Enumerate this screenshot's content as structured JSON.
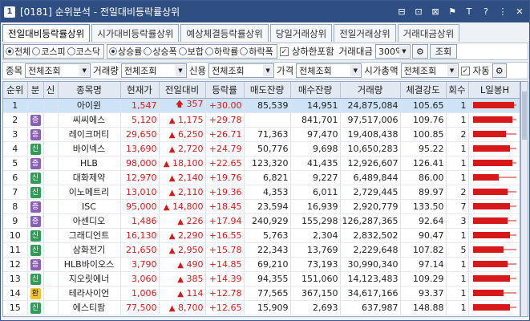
{
  "window": {
    "code": "[0181]",
    "title": "순위분석 - 전일대비등락률상위",
    "num_icon": "1"
  },
  "title_tools": [
    "⊟",
    "⊡",
    "⊠",
    "⚑",
    "T",
    "?",
    "⋮",
    "✕"
  ],
  "tabs": [
    "전일대비등락률상위",
    "시가대비등락률상위",
    "예상체결등락률상위",
    "당일거래상위",
    "전일거래상위",
    "거래대금상위"
  ],
  "filters": {
    "market": [
      "전체",
      "코스피",
      "코스닥"
    ],
    "market_selected": 0,
    "direction": [
      "상승률",
      "상승폭",
      "보합",
      "하락률",
      "하락폭"
    ],
    "direction_selected": 0,
    "limit_include_label": "상하한포함",
    "trade_amount_label": "거래대금",
    "trade_amount_value": "300억",
    "query_button": "조회",
    "item_label": "종목",
    "item_value": "전체조회",
    "volume_label": "거래량",
    "volume_value": "전체조회",
    "credit_label": "신용",
    "credit_value": "전체조회",
    "price_label": "가격",
    "price_value": "전체조회",
    "mktcap_label": "시가총액",
    "mktcap_value": "전체조회",
    "auto_label": "자동"
  },
  "columns": [
    "순위",
    "분",
    "신",
    "종목명",
    "현재가",
    "전일대비",
    "등락률",
    "매도잔량",
    "매수잔량",
    "거래량",
    "체결강도",
    "회수",
    "L일봉H"
  ],
  "rows": [
    {
      "rank": "1",
      "tag": "",
      "name": "아이윈",
      "price": "1,547",
      "change": "357",
      "rate": "+30.00",
      "ask": "85,539",
      "bid": "14,951",
      "volume": "24,875,084",
      "strength": "105.65",
      "count": "1",
      "bar": 0.95
    },
    {
      "rank": "2",
      "tag": "증",
      "name": "씨씨에스",
      "price": "5,120",
      "change": "1,175",
      "rate": "+29.78",
      "ask": "",
      "bid": "841,701",
      "volume": "97,517,006",
      "strength": "109.76",
      "count": "1",
      "bar": 0.9
    },
    {
      "rank": "3",
      "tag": "증",
      "name": "레이크머티",
      "price": "29,650",
      "change": "6,250",
      "rate": "+26.71",
      "ask": "71,363",
      "bid": "97,470",
      "volume": "19,408,438",
      "strength": "100.85",
      "count": "2",
      "bar": 0.75
    },
    {
      "rank": "4",
      "tag": "신",
      "name": "바이넥스",
      "price": "13,690",
      "change": "2,720",
      "rate": "+24.79",
      "ask": "50,776",
      "bid": "9,698",
      "volume": "10,650,283",
      "strength": "95.22",
      "count": "1",
      "bar": 0.85
    },
    {
      "rank": "5",
      "tag": "증",
      "name": "HLB",
      "price": "98,000",
      "change": "18,100",
      "rate": "+22.65",
      "ask": "123,320",
      "bid": "41,435",
      "volume": "12,926,607",
      "strength": "126.41",
      "count": "1",
      "bar": 0.9
    },
    {
      "rank": "6",
      "tag": "신",
      "name": "대화제약",
      "price": "12,970",
      "change": "2,140",
      "rate": "+19.76",
      "ask": "6,821",
      "bid": "9,227",
      "volume": "6,489,844",
      "strength": "86.00",
      "count": "1",
      "bar": 0.6
    },
    {
      "rank": "7",
      "tag": "신",
      "name": "이노메트리",
      "price": "13,010",
      "change": "2,110",
      "rate": "+19.36",
      "ask": "4,353",
      "bid": "6,011",
      "volume": "2,729,445",
      "strength": "89.97",
      "count": "2",
      "bar": 0.8
    },
    {
      "rank": "8",
      "tag": "증",
      "name": "ISC",
      "price": "95,000",
      "change": "14,800",
      "rate": "+18.45",
      "ask": "23,594",
      "bid": "16,939",
      "volume": "2,920,779",
      "strength": "133.50",
      "count": "7",
      "bar": 0.85
    },
    {
      "rank": "9",
      "tag": "증",
      "name": "아센디오",
      "price": "1,486",
      "change": "226",
      "rate": "+17.94",
      "ask": "240,929",
      "bid": "155,298",
      "volume": "126,287,365",
      "strength": "92.64",
      "count": "3",
      "bar": 0.8
    },
    {
      "rank": "10",
      "tag": "신",
      "name": "그래디언트",
      "price": "16,130",
      "change": "2,290",
      "rate": "+16.55",
      "ask": "5,763",
      "bid": "2,304",
      "volume": "2,832,502",
      "strength": "90.47",
      "count": "1",
      "bar": 0.85
    },
    {
      "rank": "11",
      "tag": "신",
      "name": "삼화전기",
      "price": "21,650",
      "change": "2,950",
      "rate": "+15.78",
      "ask": "22,343",
      "bid": "13,769",
      "volume": "2,229,648",
      "strength": "107.82",
      "count": "5",
      "bar": 0.7
    },
    {
      "rank": "12",
      "tag": "증",
      "name": "HLB바이오스",
      "price": "3,790",
      "change": "490",
      "rate": "+14.85",
      "ask": "69,210",
      "bid": "73,193",
      "volume": "30,990,340",
      "strength": "97.14",
      "count": "1",
      "bar": 0.8
    },
    {
      "rank": "13",
      "tag": "신",
      "name": "지오릿에너",
      "price": "3,060",
      "change": "385",
      "rate": "+14.39",
      "ask": "94,355",
      "bid": "151,060",
      "volume": "14,123,483",
      "strength": "109.29",
      "count": "1",
      "bar": 0.85
    },
    {
      "rank": "14",
      "tag": "환",
      "name": "테라사이언",
      "price": "1,006",
      "change": "114",
      "rate": "+12.78",
      "ask": "77,565",
      "bid": "367,150",
      "volume": "34,617,166",
      "strength": "93.37",
      "count": "1",
      "bar": 0.7
    },
    {
      "rank": "15",
      "tag": "신",
      "name": "에스티팜",
      "price": "77,500",
      "change": "8,700",
      "rate": "+12.65",
      "ask": "15,909",
      "bid": "2,693",
      "volume": "637,987",
      "strength": "148.88",
      "count": "1",
      "bar": 0.85
    }
  ],
  "colors": {
    "up": "#d7191c",
    "title_bg": "#2f4f82",
    "selected_row": "#cfe3f7"
  }
}
